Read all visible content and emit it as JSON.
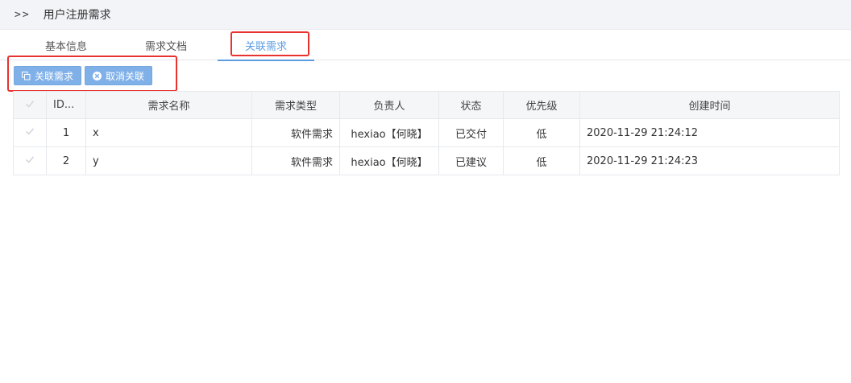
{
  "header": {
    "breadcrumb_marker": ">>",
    "title": "用户注册需求"
  },
  "tabs": [
    {
      "label": "基本信息",
      "active": false
    },
    {
      "label": "需求文档",
      "active": false
    },
    {
      "label": "关联需求",
      "active": true
    }
  ],
  "toolbar": {
    "link_label": "关联需求",
    "unlink_label": "取消关联"
  },
  "colors": {
    "accent": "#5b9de0",
    "button": "#80b0e8",
    "highlight_border": "#e8322d"
  },
  "table": {
    "columns": [
      "ID...",
      "需求名称",
      "需求类型",
      "负责人",
      "状态",
      "优先级",
      "创建时间"
    ],
    "rows": [
      {
        "id": "1",
        "name": "x",
        "type": "软件需求",
        "owner": "hexiao【何晓】",
        "status": "已交付",
        "priority": "低",
        "created": "2020-11-29 21:24:12"
      },
      {
        "id": "2",
        "name": "y",
        "type": "软件需求",
        "owner": "hexiao【何晓】",
        "status": "已建议",
        "priority": "低",
        "created": "2020-11-29 21:24:23"
      }
    ]
  }
}
